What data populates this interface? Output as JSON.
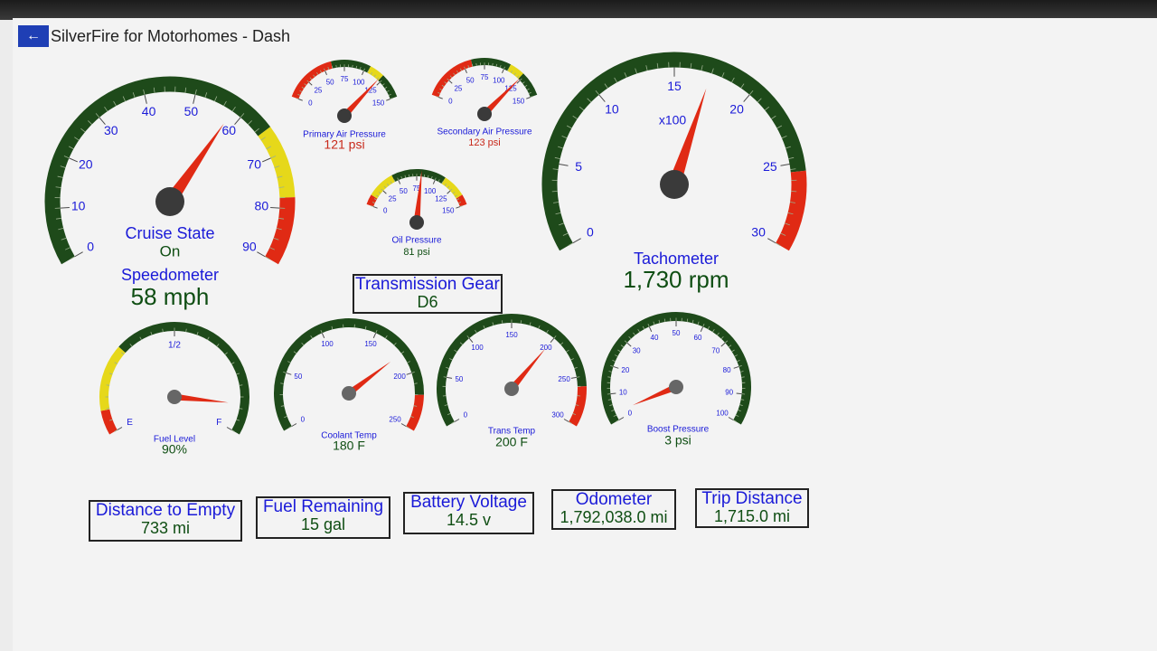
{
  "window": {
    "title": "SilverFire for Motorhomes - Dash",
    "back_icon": "back-arrow-icon"
  },
  "colors": {
    "arc_green": "#1e4a1a",
    "yellow": "#e6d81a",
    "red": "#e02a14",
    "label_blue": "#1a1ad8",
    "value_green": "#0f4e13",
    "needle_red": "#e02a14",
    "hub": "#3a3a3a",
    "small_value_red": "#c8281a"
  },
  "gauges": {
    "speedometer": {
      "label": "Speedometer",
      "value": "58 mph",
      "reading": 58,
      "ticks": [
        "0",
        "10",
        "20",
        "30",
        "40",
        "50",
        "60",
        "70",
        "80",
        "90"
      ],
      "cruise_label": "Cruise State",
      "cruise_value": "On"
    },
    "primary_air": {
      "label": "Primary Air Pressure",
      "value": "121 psi",
      "reading": 121,
      "ticks": [
        "0",
        "25",
        "50",
        "75",
        "100",
        "125",
        "150"
      ]
    },
    "secondary_air": {
      "label": "Secondary Air Pressure",
      "value": "123 psi",
      "reading": 123,
      "ticks": [
        "0",
        "25",
        "50",
        "75",
        "100",
        "125",
        "150"
      ]
    },
    "oil_pressure": {
      "label": "Oil Pressure",
      "value": "81 psi",
      "reading": 81,
      "ticks": [
        "0",
        "25",
        "50",
        "75",
        "100",
        "125",
        "150"
      ]
    },
    "tachometer": {
      "label": "Tachometer",
      "value": "1,730 rpm",
      "reading": 17.3,
      "unit_label": "x100",
      "ticks": [
        "0",
        "5",
        "10",
        "15",
        "20",
        "25",
        "30"
      ]
    },
    "fuel_level": {
      "label": "Fuel Level",
      "value": "90%",
      "reading": 0.9,
      "ticks": [
        "E",
        "1/2",
        "F"
      ]
    },
    "coolant_temp": {
      "label": "Coolant Temp",
      "value": "180 F",
      "reading": 180,
      "ticks": [
        "0",
        "50",
        "100",
        "150",
        "200",
        "250"
      ]
    },
    "trans_temp": {
      "label": "Trans Temp",
      "value": "200 F",
      "reading": 200,
      "ticks": [
        "0",
        "50",
        "100",
        "150",
        "200",
        "250",
        "300"
      ]
    },
    "boost_pressure": {
      "label": "Boost Pressure",
      "value": "3 psi",
      "reading": 3,
      "ticks": [
        "0",
        "10",
        "20",
        "30",
        "40",
        "50",
        "60",
        "70",
        "80",
        "90",
        "100"
      ]
    }
  },
  "info_boxes": {
    "transmission_gear": {
      "label": "Transmission Gear",
      "value": "D6"
    },
    "distance_to_empty": {
      "label": "Distance to Empty",
      "value": "733 mi"
    },
    "fuel_remaining": {
      "label": "Fuel Remaining",
      "value": "15 gal"
    },
    "battery_voltage": {
      "label": "Battery Voltage",
      "value": "14.5 v"
    },
    "odometer": {
      "label": "Odometer",
      "value": "1,792,038.0 mi"
    },
    "trip_distance": {
      "label": "Trip Distance",
      "value": "1,715.0 mi"
    }
  }
}
